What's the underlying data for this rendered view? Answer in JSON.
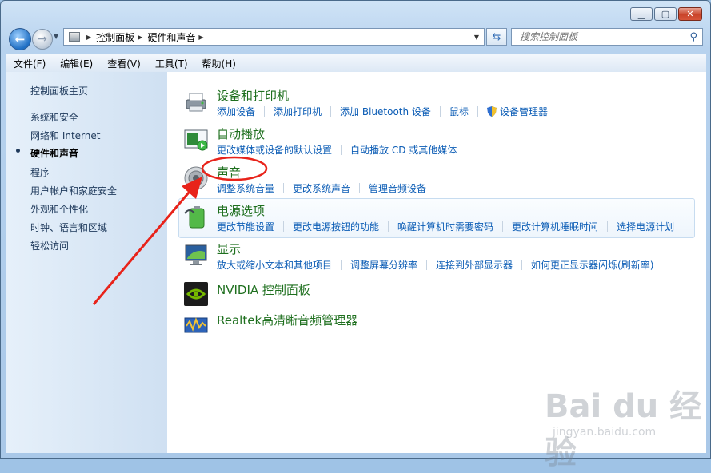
{
  "window": {
    "caption_buttons": [
      "minimize",
      "maximize",
      "close"
    ]
  },
  "address_bar": {
    "crumbs": [
      "控制面板",
      "硬件和声音"
    ]
  },
  "search": {
    "placeholder": "搜索控制面板"
  },
  "menubar": [
    "文件(F)",
    "编辑(E)",
    "查看(V)",
    "工具(T)",
    "帮助(H)"
  ],
  "sidebar": {
    "items": [
      {
        "label": "控制面板主页",
        "active": false
      },
      {
        "label": "系统和安全",
        "active": false
      },
      {
        "label": "网络和 Internet",
        "active": false
      },
      {
        "label": "硬件和声音",
        "active": true
      },
      {
        "label": "程序",
        "active": false
      },
      {
        "label": "用户帐户和家庭安全",
        "active": false
      },
      {
        "label": "外观和个性化",
        "active": false
      },
      {
        "label": "时钟、语言和区域",
        "active": false
      },
      {
        "label": "轻松访问",
        "active": false
      }
    ]
  },
  "categories": [
    {
      "title": "设备和打印机",
      "icon": "printer-icon",
      "links": [
        "添加设备",
        "添加打印机",
        "添加 Bluetooth 设备",
        "鼠标",
        "设备管理器"
      ]
    },
    {
      "title": "自动播放",
      "icon": "autoplay-icon",
      "links": [
        "更改媒体或设备的默认设置",
        "自动播放 CD 或其他媒体"
      ]
    },
    {
      "title": "声音",
      "icon": "speaker-icon",
      "links": [
        "调整系统音量",
        "更改系统声音",
        "管理音频设备"
      ]
    },
    {
      "title": "电源选项",
      "icon": "battery-icon",
      "links": [
        "更改节能设置",
        "更改电源按钮的功能",
        "唤醒计算机时需要密码",
        "更改计算机睡眠时间",
        "选择电源计划"
      ]
    },
    {
      "title": "显示",
      "icon": "monitor-icon",
      "links": [
        "放大或缩小文本和其他项目",
        "调整屏幕分辨率",
        "连接到外部显示器",
        "如何更正显示器闪烁(刷新率)"
      ]
    },
    {
      "title": "NVIDIA 控制面板",
      "icon": "nvidia-icon",
      "links": []
    },
    {
      "title": "Realtek高清晰音频管理器",
      "icon": "realtek-icon",
      "links": []
    }
  ],
  "watermark": {
    "brand": "Bai du 经验",
    "url": "jingyan.baidu.com"
  },
  "colors": {
    "link": "#0b5cb5",
    "category_title": "#1e6f1e",
    "annotation": "#e8231a"
  }
}
